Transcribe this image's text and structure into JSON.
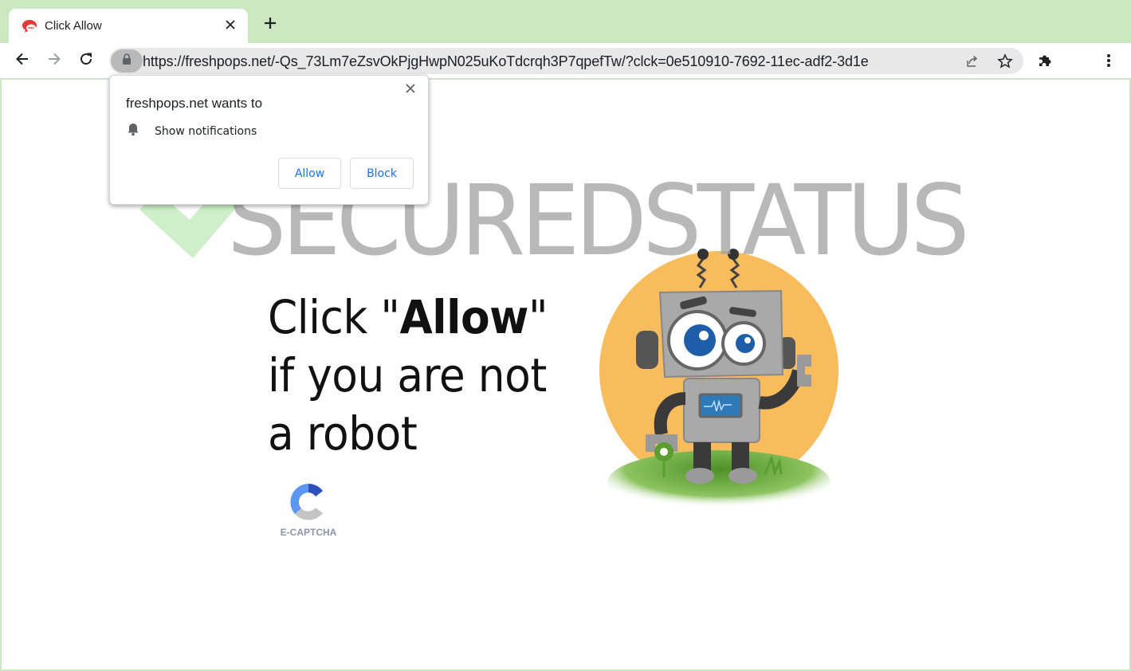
{
  "browser": {
    "tab": {
      "title": "Click Allow",
      "favicon": "chat-bubble-icon",
      "close_icon": "close-icon"
    },
    "new_tab_icon": "plus-icon",
    "toolbar": {
      "back_icon": "arrow-left-icon",
      "forward_icon": "arrow-right-icon",
      "reload_icon": "reload-icon",
      "site_info_icon": "lock-icon",
      "url": "https://freshpops.net/-Qs_73Lm7eZsvOkPjgHwpN025uKoTdcrqh3P7qpefTw/?clck=0e510910-7692-11ec-adf2-3d1e",
      "share_icon": "share-icon",
      "bookmark_icon": "star-icon",
      "extensions_icon": "puzzle-icon",
      "menu_icon": "kebab-menu-icon"
    }
  },
  "permission_popup": {
    "title": "freshpops.net wants to",
    "permission_icon": "bell-icon",
    "permission_label": "Show notifications",
    "allow_label": "Allow",
    "block_label": "Block",
    "close_icon": "close-icon"
  },
  "page": {
    "headline_prefix": "Click \"",
    "headline_bold": "Allow",
    "headline_suffix": "\" if you are not a robot",
    "captcha_label": "E-CAPTCHA",
    "robot_illustration": "robot-illustration"
  },
  "watermark": {
    "text": "SECUREDSTATUS",
    "icon": "checkmark-icon"
  },
  "colors": {
    "frame": "#cbe8c0",
    "omnibox": "#e8e8e8",
    "link_blue": "#1a73e8",
    "robot_bg": "#f8bc5c",
    "watermark_green": "#c5ecc0",
    "watermark_gray": "#a0a0a0"
  }
}
